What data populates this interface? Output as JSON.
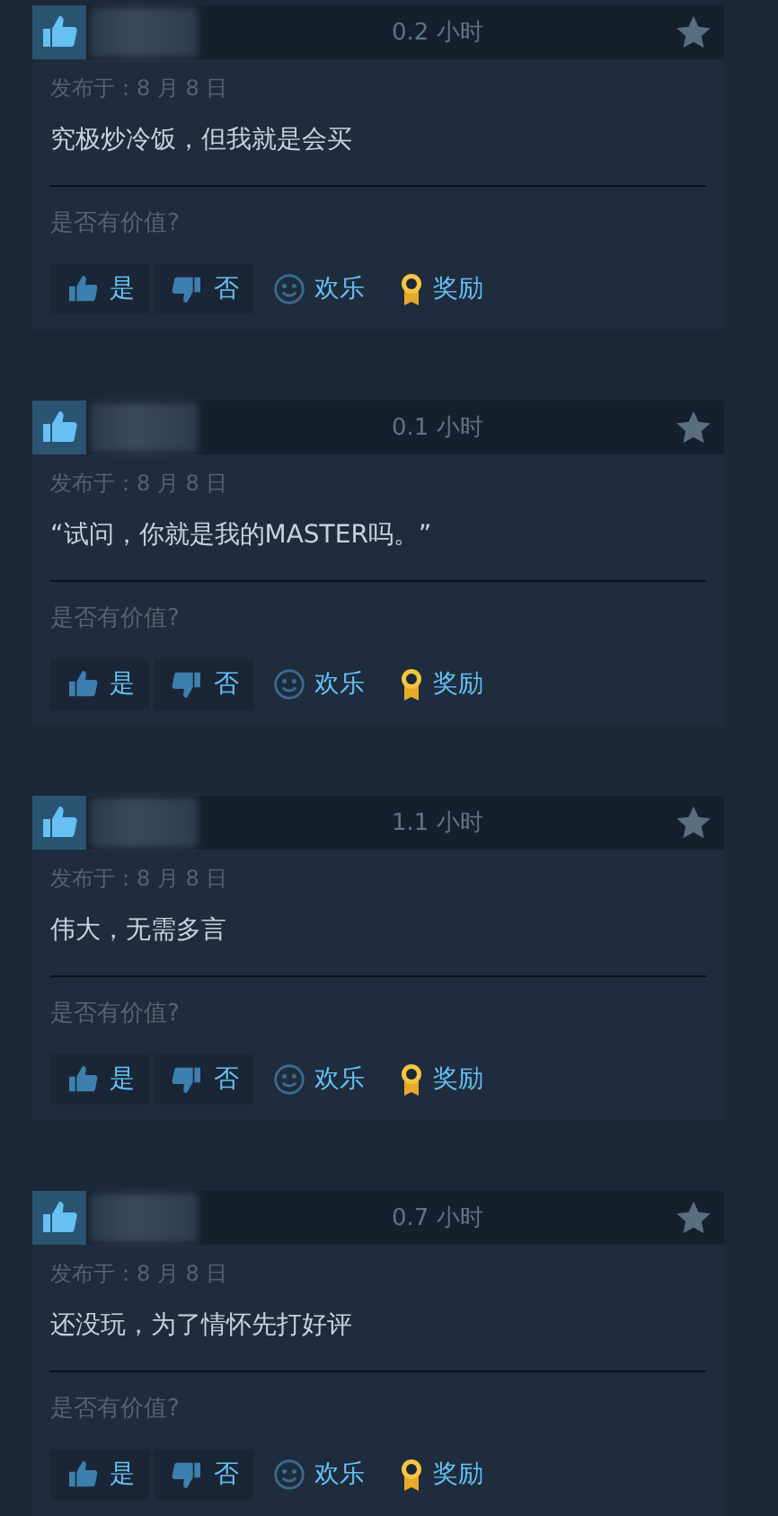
{
  "reviews": [
    {
      "hours": "0.2 小时",
      "posted": "发布于：8 月 8 日",
      "text": "究极炒冷饭，但我就是会买",
      "question": "是否有价值?",
      "actions": [
        {
          "kind": "yes",
          "label": "是"
        },
        {
          "kind": "no",
          "label": "否"
        },
        {
          "kind": "funny",
          "label": "欢乐"
        },
        {
          "kind": "award",
          "label": "奖励"
        }
      ]
    },
    {
      "hours": "0.1 小时",
      "posted": "发布于：8 月 8 日",
      "text": "“试问，你就是我的MASTER吗。”",
      "question": "是否有价值?",
      "actions": [
        {
          "kind": "yes",
          "label": "是"
        },
        {
          "kind": "no",
          "label": "否"
        },
        {
          "kind": "funny",
          "label": "欢乐"
        },
        {
          "kind": "award",
          "label": "奖励"
        }
      ]
    },
    {
      "hours": "1.1 小时",
      "posted": "发布于：8 月 8 日",
      "text": "伟大，无需多言",
      "question": "是否有价值?",
      "actions": [
        {
          "kind": "yes",
          "label": "是"
        },
        {
          "kind": "no",
          "label": "否"
        },
        {
          "kind": "funny",
          "label": "欢乐"
        },
        {
          "kind": "award",
          "label": "奖励"
        }
      ]
    },
    {
      "hours": "0.7 小时",
      "posted": "发布于：8 月 8 日",
      "text": "还没玩，为了情怀先打好评",
      "question": "是否有价值?",
      "actions": [
        {
          "kind": "yes",
          "label": "是"
        },
        {
          "kind": "no",
          "label": "否"
        },
        {
          "kind": "funny",
          "label": "欢乐"
        },
        {
          "kind": "award",
          "label": "奖励"
        }
      ]
    }
  ]
}
